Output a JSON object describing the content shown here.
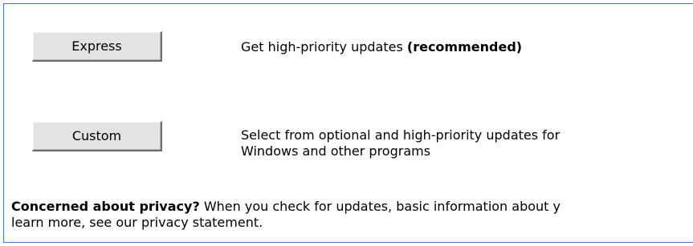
{
  "express": {
    "button_label": "Express",
    "description": "Get high-priority updates",
    "recommended": "(recommended)"
  },
  "custom": {
    "button_label": "Custom",
    "description_line1": "Select from optional and high-priority updates for",
    "description_line2": "Windows and other programs"
  },
  "privacy": {
    "heading": "Concerned about privacy?",
    "line1_text": "When you check for updates, basic information about y",
    "line2_text": "learn more, see our privacy statement."
  }
}
